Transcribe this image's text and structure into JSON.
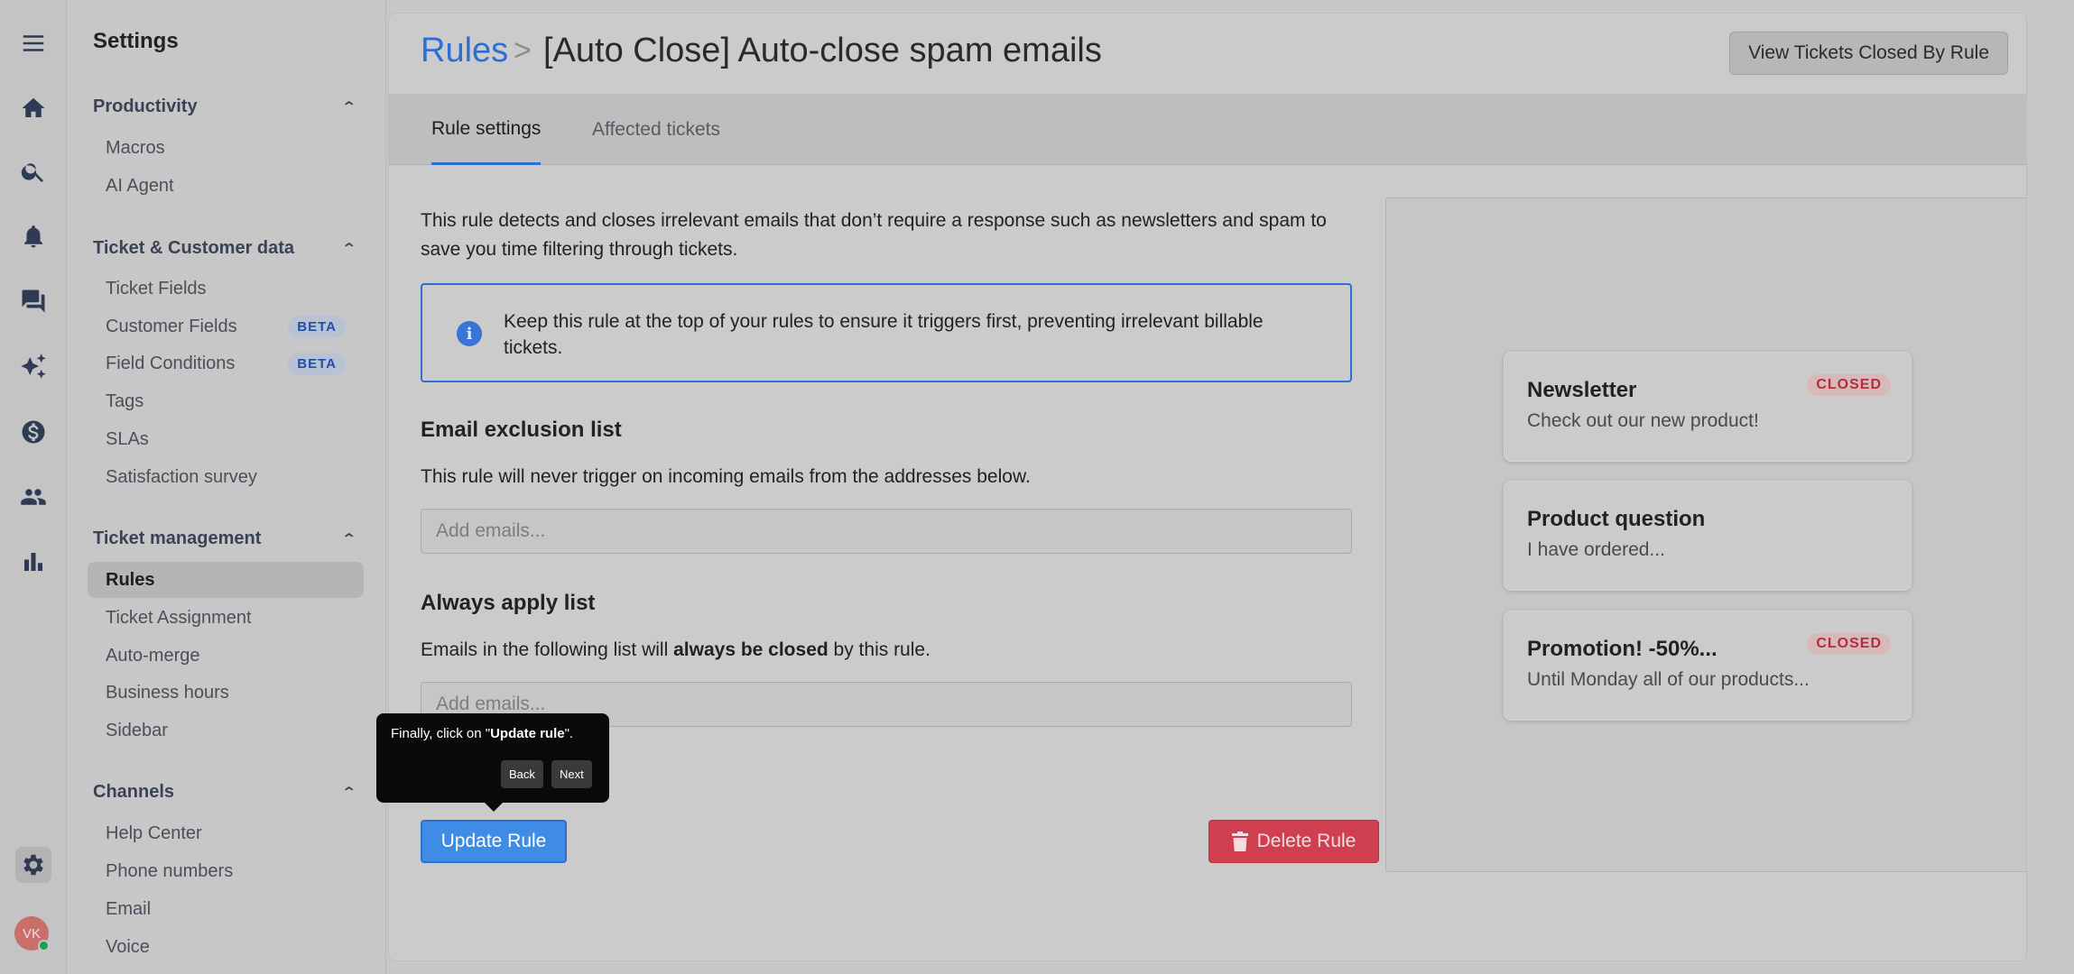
{
  "rail": {
    "icons": [
      "menu-icon",
      "home-icon",
      "search-icon",
      "bell-icon",
      "chat-icon",
      "sparkles-icon",
      "dollar-icon",
      "users-icon",
      "bar-chart-icon",
      "gear-icon"
    ],
    "avatar_initials": "VK"
  },
  "sidebar": {
    "title": "Settings",
    "sections": {
      "productivity": {
        "label": "Productivity",
        "items": [
          "Macros",
          "AI Agent"
        ]
      },
      "ticket_customer": {
        "label": "Ticket & Customer data",
        "items": [
          "Ticket Fields",
          "Customer Fields",
          "Field Conditions",
          "Tags",
          "SLAs",
          "Satisfaction survey"
        ]
      },
      "ticket_management": {
        "label": "Ticket management",
        "items": [
          "Rules",
          "Ticket Assignment",
          "Auto-merge",
          "Business hours",
          "Sidebar"
        ]
      },
      "channels": {
        "label": "Channels",
        "items": [
          "Help Center",
          "Phone numbers",
          "Email",
          "Voice"
        ]
      }
    },
    "beta_label": "BETA"
  },
  "header": {
    "breadcrumb_link": "Rules",
    "breadcrumb_sep": ">",
    "title": "[Auto Close] Auto-close spam emails",
    "view_button": "View Tickets Closed By Rule"
  },
  "tabs": [
    "Rule settings",
    "Affected tickets"
  ],
  "main": {
    "description": "This rule detects and closes irrelevant emails that don’t require a response such as newsletters and spam to save you time filtering through tickets.",
    "info": "Keep this rule at the top of your rules to ensure it triggers first, preventing irrelevant billable tickets.",
    "exclusion": {
      "heading": "Email exclusion list",
      "text": "This rule will never trigger on incoming emails from the addresses below.",
      "placeholder": "Add emails..."
    },
    "always": {
      "heading": "Always apply list",
      "text_before": "Emails in the following list will ",
      "text_bold": "always be closed",
      "text_after": " by this rule.",
      "placeholder": "Add emails..."
    },
    "update_button": "Update Rule",
    "delete_button": "Delete Rule"
  },
  "preview": {
    "cards": [
      {
        "title": "Newsletter",
        "subtitle": "Check out our new product!",
        "badge": "CLOSED"
      },
      {
        "title": "Product question",
        "subtitle": "I have ordered...",
        "badge": ""
      },
      {
        "title": "Promotion! -50%...",
        "subtitle": "Until Monday all of our products...",
        "badge": "CLOSED"
      }
    ]
  },
  "tooltip": {
    "text_before": "Finally, click on \"",
    "text_bold": "Update rule",
    "text_after": "\".",
    "back": "Back",
    "next": "Next"
  },
  "colors": {
    "accent": "#2b6fd4",
    "danger": "#cf3f4f",
    "closed_badge": "#b32d3a"
  }
}
